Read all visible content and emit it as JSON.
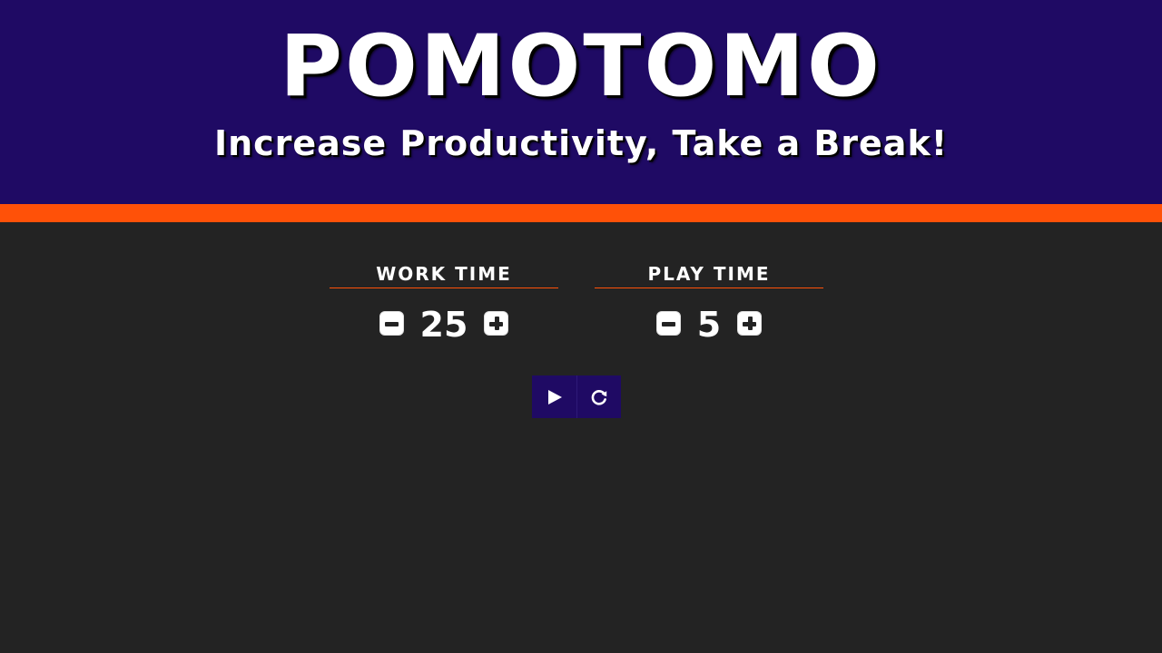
{
  "header": {
    "title": "POMOTOMO",
    "subtitle": "Increase Productivity, Take a Break!"
  },
  "settings": {
    "work": {
      "label": "WORK TIME",
      "value": "25"
    },
    "play": {
      "label": "PLAY TIME",
      "value": "5"
    }
  },
  "controls": {
    "icons": [
      "play-icon",
      "reset-icon"
    ]
  },
  "colors": {
    "header_bg": "#1f0a64",
    "accent": "#ff5108",
    "body_bg": "#232323",
    "text": "#ffffff"
  }
}
